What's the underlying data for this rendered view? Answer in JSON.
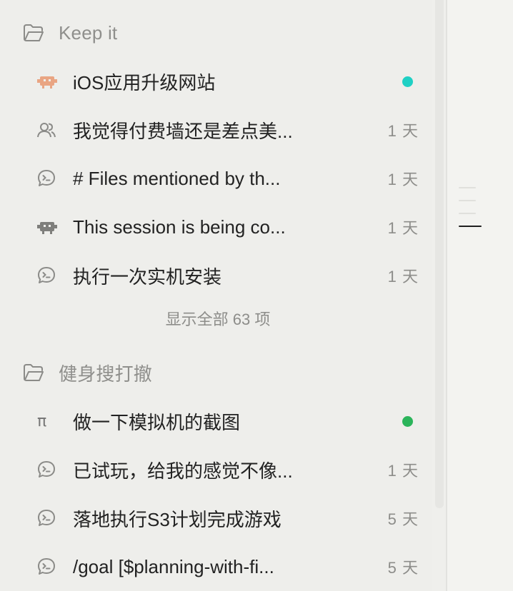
{
  "groups": [
    {
      "title": "Keep it",
      "items": [
        {
          "title": "iOS应用升级网站",
          "meta": "",
          "icon": "robot-icon",
          "status_color": "#1fd0c4"
        },
        {
          "title": "我觉得付费墙还是差点美...",
          "meta": "1 天",
          "icon": "people-icon"
        },
        {
          "title": "# Files mentioned by th...",
          "meta": "1 天",
          "icon": "chat-terminal-icon"
        },
        {
          "title": "This session is being co...",
          "meta": "1 天",
          "icon": "robot-icon"
        },
        {
          "title": "执行一次实机安装",
          "meta": "1 天",
          "icon": "chat-terminal-icon"
        }
      ],
      "show_all": "显示全部 63 项"
    },
    {
      "title": "健身搜打撤",
      "items": [
        {
          "title": "做一下模拟机的截图",
          "meta": "",
          "icon": "pi-icon",
          "icon_text": "π",
          "status_color": "#2bb45a"
        },
        {
          "title": "已试玩，给我的感觉不像...",
          "meta": "1 天",
          "icon": "chat-terminal-icon"
        },
        {
          "title": "落地执行S3计划完成游戏",
          "meta": "5 天",
          "icon": "chat-terminal-icon"
        },
        {
          "title": "/goal [$planning-with-fi...",
          "meta": "5 天",
          "icon": "chat-terminal-icon"
        }
      ]
    }
  ],
  "colors": {
    "robot_active": "#e9a583",
    "robot_idle": "#7f7f7c",
    "icon_gray": "#8b8b88"
  }
}
